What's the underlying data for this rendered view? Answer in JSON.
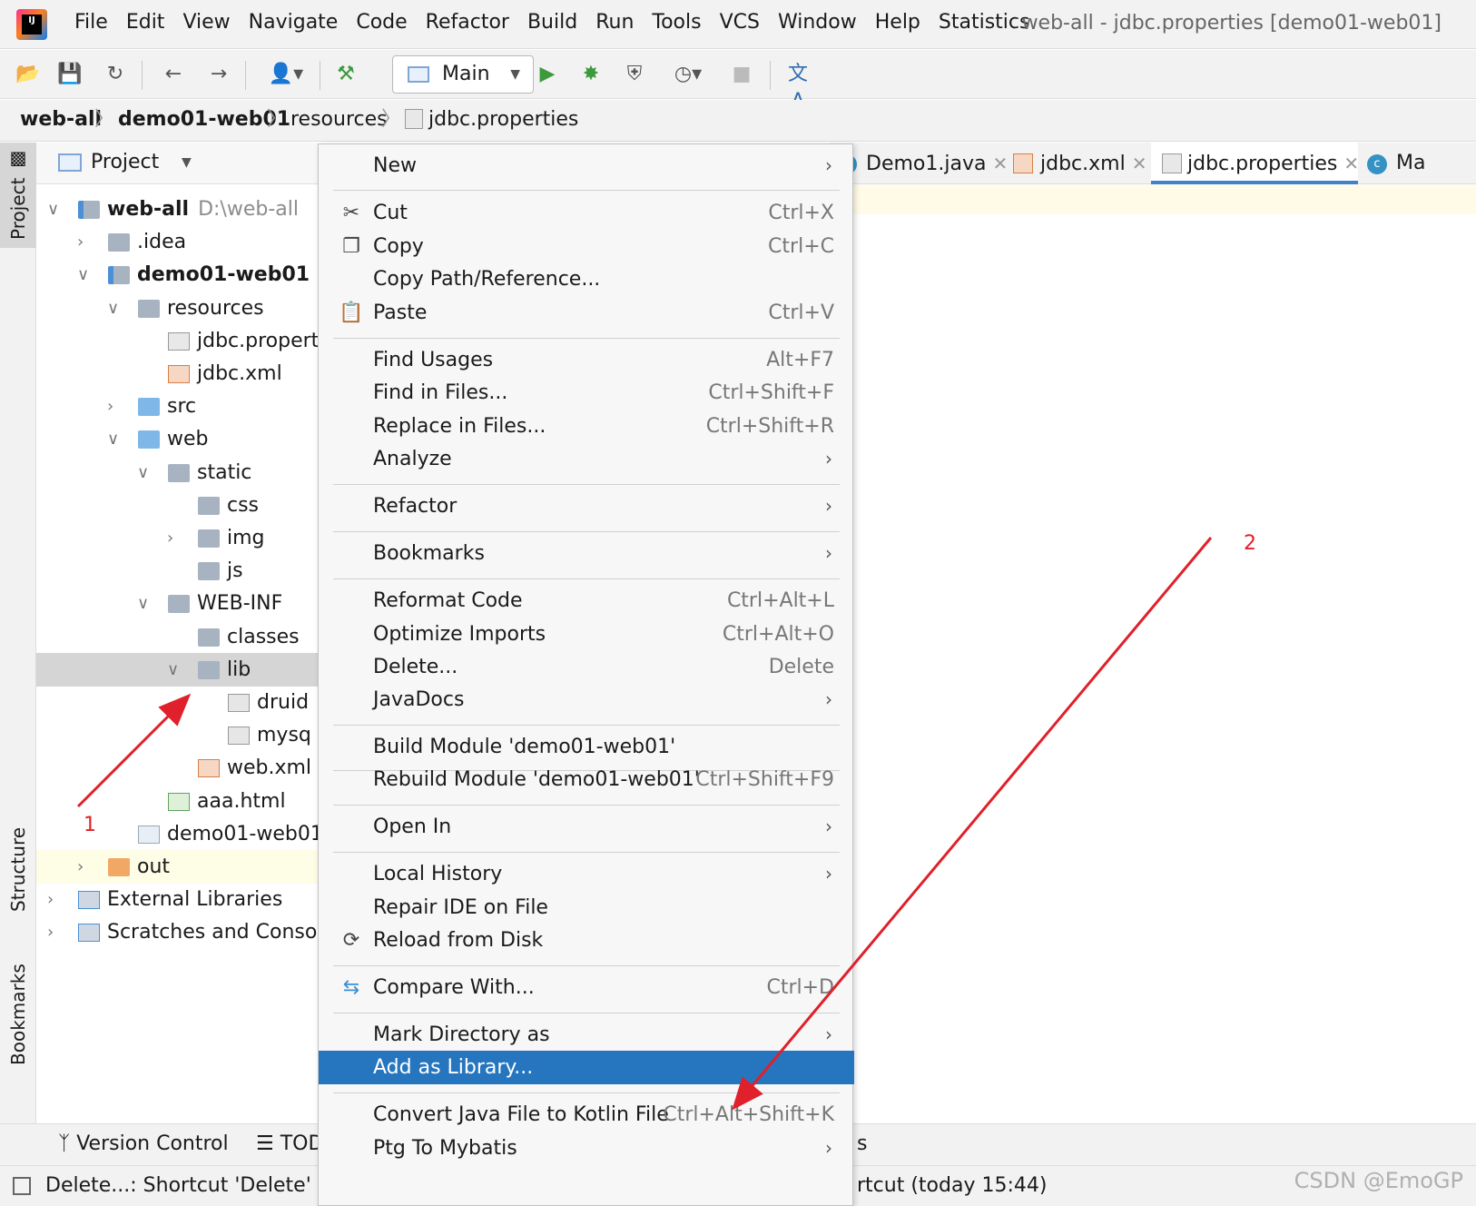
{
  "menubar": {
    "items": [
      "File",
      "Edit",
      "View",
      "Navigate",
      "Code",
      "Refactor",
      "Build",
      "Run",
      "Tools",
      "VCS",
      "Window",
      "Help",
      "Statistics"
    ],
    "window_title": "web-all - jdbc.properties [demo01-web01]"
  },
  "toolbar": {
    "run_config": "Main",
    "icons": [
      "open-icon",
      "save-icon",
      "sync-icon",
      "back-icon",
      "forward-icon",
      "user-icon",
      "build-hammer-icon",
      "run-icon",
      "debug-icon",
      "coverage-icon",
      "profile-icon",
      "stop-icon",
      "translate-icon"
    ]
  },
  "breadcrumb": [
    "web-all",
    "demo01-web01",
    "resources",
    "jdbc.properties"
  ],
  "side_tabs": {
    "project": "Project",
    "structure": "Structure",
    "bookmarks": "Bookmarks"
  },
  "project": {
    "title": "Project",
    "tree": [
      {
        "label": "web-all",
        "hint": "D:\\web-all",
        "bold": true,
        "icon": "module-folder-icon"
      },
      {
        "label": ".idea",
        "icon": "folder-icon"
      },
      {
        "label": "demo01-web01",
        "bold": true,
        "icon": "module-folder-icon"
      },
      {
        "label": "resources",
        "icon": "resources-folder-icon"
      },
      {
        "label": "jdbc.propert",
        "icon": "properties-file-icon"
      },
      {
        "label": "jdbc.xml",
        "icon": "xml-file-icon"
      },
      {
        "label": "src",
        "icon": "source-folder-icon"
      },
      {
        "label": "web",
        "icon": "web-folder-icon"
      },
      {
        "label": "static",
        "icon": "folder-icon"
      },
      {
        "label": "css",
        "icon": "folder-icon"
      },
      {
        "label": "img",
        "icon": "folder-icon"
      },
      {
        "label": "js",
        "icon": "folder-icon"
      },
      {
        "label": "WEB-INF",
        "icon": "folder-icon"
      },
      {
        "label": "classes",
        "icon": "folder-icon"
      },
      {
        "label": "lib",
        "icon": "folder-icon",
        "selected": true
      },
      {
        "label": "druid",
        "icon": "jar-file-icon"
      },
      {
        "label": "mysq",
        "icon": "jar-file-icon"
      },
      {
        "label": "web.xml",
        "icon": "web-xml-icon"
      },
      {
        "label": "aaa.html",
        "icon": "html-file-icon"
      },
      {
        "label": "demo01-web01",
        "icon": "iml-file-icon"
      },
      {
        "label": "out",
        "icon": "excluded-folder-icon"
      },
      {
        "label": "External Libraries",
        "icon": "libraries-icon"
      },
      {
        "label": "Scratches and Console",
        "icon": "scratches-icon"
      }
    ]
  },
  "tabs": [
    "Demo1.java",
    "jdbc.xml",
    "jdbc.properties",
    "Ma"
  ],
  "context_menu": [
    {
      "label": "New",
      "submenu": true
    },
    {
      "label": "Cut",
      "shortcut": "Ctrl+X",
      "icon": "cut-icon"
    },
    {
      "label": "Copy",
      "shortcut": "Ctrl+C",
      "icon": "copy-icon"
    },
    {
      "label": "Copy Path/Reference..."
    },
    {
      "label": "Paste",
      "shortcut": "Ctrl+V",
      "icon": "paste-icon"
    },
    {
      "label": "Find Usages",
      "shortcut": "Alt+F7"
    },
    {
      "label": "Find in Files...",
      "shortcut": "Ctrl+Shift+F"
    },
    {
      "label": "Replace in Files...",
      "shortcut": "Ctrl+Shift+R"
    },
    {
      "label": "Analyze",
      "submenu": true
    },
    {
      "label": "Refactor",
      "submenu": true
    },
    {
      "label": "Bookmarks",
      "submenu": true
    },
    {
      "label": "Reformat Code",
      "shortcut": "Ctrl+Alt+L"
    },
    {
      "label": "Optimize Imports",
      "shortcut": "Ctrl+Alt+O"
    },
    {
      "label": "Delete...",
      "shortcut": "Delete"
    },
    {
      "label": "JavaDocs",
      "submenu": true
    },
    {
      "label": "Build Module 'demo01-web01'"
    },
    {
      "label": "Rebuild Module 'demo01-web01'",
      "shortcut": "Ctrl+Shift+F9"
    },
    {
      "label": "Open In",
      "submenu": true
    },
    {
      "label": "Local History",
      "submenu": true
    },
    {
      "label": "Repair IDE on File"
    },
    {
      "label": "Reload from Disk",
      "icon": "reload-icon"
    },
    {
      "label": "Compare With...",
      "shortcut": "Ctrl+D",
      "icon": "compare-icon"
    },
    {
      "label": "Mark Directory as",
      "submenu": true
    },
    {
      "label": "Add as Library...",
      "highlighted": true
    },
    {
      "label": "Convert Java File to Kotlin File",
      "shortcut": "Ctrl+Alt+Shift+K"
    },
    {
      "label": "Ptg To Mybatis",
      "submenu": true
    }
  ],
  "bottom_bar": {
    "version_control": "Version Control",
    "todo": "TOD",
    "right": "s"
  },
  "status": {
    "left": "Delete...: Shortcut 'Delete' mi",
    "right": "rtcut (today 15:44)"
  },
  "annotations": {
    "label1": "1",
    "label2": "2"
  },
  "watermark": "CSDN @EmoGP",
  "colors": {
    "accent": "#2675bf",
    "annotation": "#e0202a"
  }
}
